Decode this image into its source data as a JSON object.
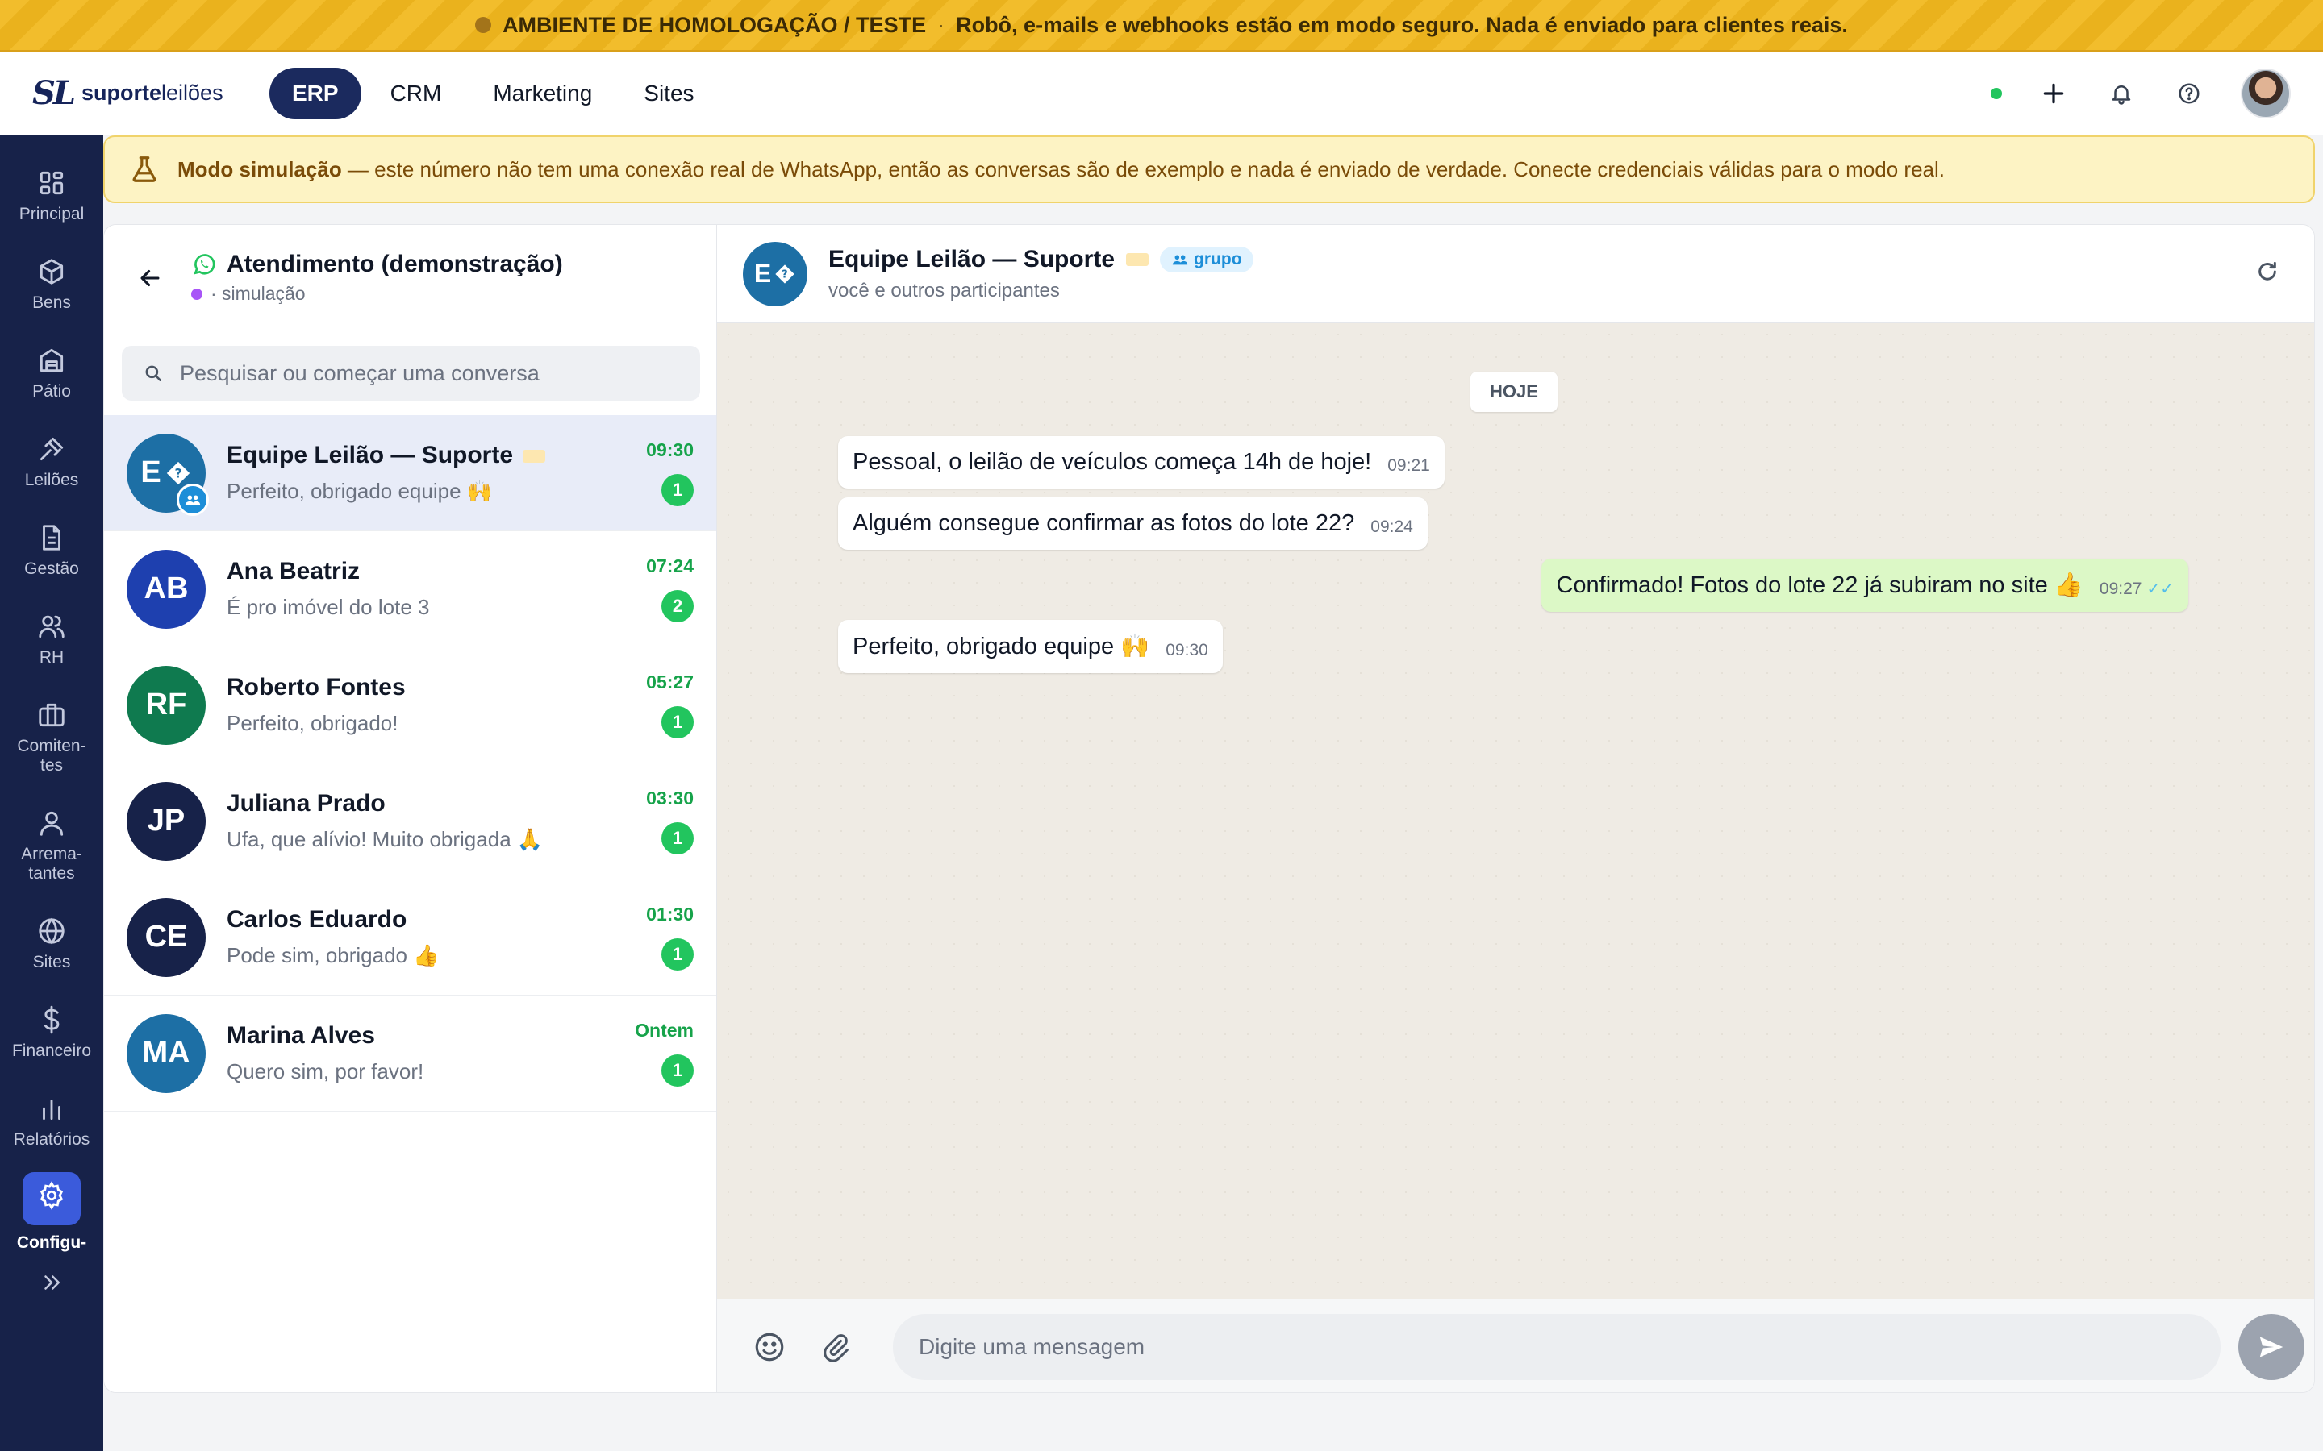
{
  "env_banner": {
    "title": "AMBIENTE DE HOMOLOGAÇÃO / TESTE",
    "separator": "·",
    "message": "Robô, e-mails e webhooks estão em modo seguro. Nada é enviado para clientes reais."
  },
  "header": {
    "logo_mark": "SL",
    "logo_bold": "suporte",
    "logo_light": "leilões",
    "tabs": [
      {
        "label": "ERP",
        "active": true
      },
      {
        "label": "CRM",
        "active": false
      },
      {
        "label": "Marketing",
        "active": false
      },
      {
        "label": "Sites",
        "active": false
      }
    ],
    "status_color": "#22c55e"
  },
  "sidebar": {
    "items": [
      {
        "label": "Principal",
        "icon": "grid-icon"
      },
      {
        "label": "Bens",
        "icon": "box-icon"
      },
      {
        "label": "Pátio",
        "icon": "warehouse-icon"
      },
      {
        "label": "Leilões",
        "icon": "gavel-icon"
      },
      {
        "label": "Gestão",
        "icon": "document-icon"
      },
      {
        "label": "RH",
        "icon": "users-icon"
      },
      {
        "label": "Comiten-\ntes",
        "icon": "briefcase-icon"
      },
      {
        "label": "Arrema-\ntantes",
        "icon": "user-icon"
      },
      {
        "label": "Sites",
        "icon": "globe-icon"
      },
      {
        "label": "Financeiro",
        "icon": "dollar-icon"
      },
      {
        "label": "Relatórios",
        "icon": "bar-chart-icon"
      },
      {
        "label": "Configu-",
        "icon": "gear-icon",
        "active": true
      }
    ],
    "expand_icon": "double-chevron-right-icon"
  },
  "sim_banner": {
    "bold": "Modo simulação",
    "text": " — este número não tem uma conexão real de WhatsApp, então as conversas são de exemplo e nada é enviado de verdade. Conecte credenciais válidas para o modo real."
  },
  "inbox": {
    "title": "Atendimento (demonstração)",
    "subtitle": "· simulação",
    "search_placeholder": "Pesquisar ou começar uma conversa",
    "conversations": [
      {
        "initials": "E",
        "name": "Equipe Leilão — Suporte",
        "preview": "Perfeito, obrigado equipe 🙌",
        "time": "09:30",
        "unread": "1",
        "color": "#1d6fa5",
        "active": true,
        "group": true
      },
      {
        "initials": "AB",
        "name": "Ana Beatriz",
        "preview": "É pro imóvel do lote 3",
        "time": "07:24",
        "unread": "2",
        "color": "#1e40af"
      },
      {
        "initials": "RF",
        "name": "Roberto Fontes",
        "preview": "Perfeito, obrigado!",
        "time": "05:27",
        "unread": "1",
        "color": "#0f7a4f"
      },
      {
        "initials": "JP",
        "name": "Juliana Prado",
        "preview": "Ufa, que alívio! Muito obrigada 🙏",
        "time": "03:30",
        "unread": "1",
        "color": "#172249"
      },
      {
        "initials": "CE",
        "name": "Carlos Eduardo",
        "preview": "Pode sim, obrigado 👍",
        "time": "01:30",
        "unread": "1",
        "color": "#172249"
      },
      {
        "initials": "MA",
        "name": "Marina Alves",
        "preview": "Quero sim, por favor!",
        "time": "Ontem",
        "unread": "1",
        "color": "#1d6fa5"
      }
    ]
  },
  "chat": {
    "avatar_initials": "E",
    "title": "Equipe Leilão — Suporte",
    "group_tag": "grupo",
    "subtitle": "você e outros participantes",
    "day_chip": "HOJE",
    "messages": [
      {
        "text": "Pessoal, o leilão de veículos começa 14h de hoje!",
        "time": "09:21",
        "out": false
      },
      {
        "text": "Alguém consegue confirmar as fotos do lote 22?",
        "time": "09:24",
        "out": false
      },
      {
        "text": "Confirmado! Fotos do lote 22 já subiram no site 👍",
        "time": "09:27",
        "out": true,
        "ticks": "✓✓"
      },
      {
        "text": "Perfeito, obrigado equipe 🙌",
        "time": "09:30",
        "out": false
      }
    ],
    "composer_placeholder": "Digite uma mensagem"
  }
}
